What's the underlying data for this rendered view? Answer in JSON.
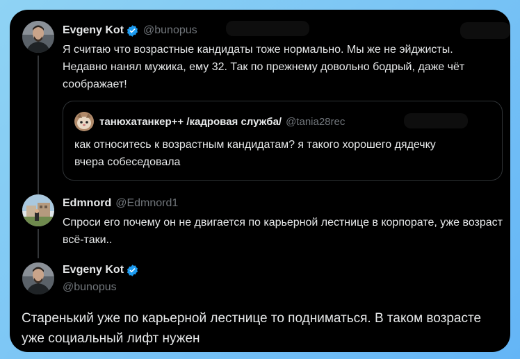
{
  "tweet1": {
    "name": "Evgeny Kot",
    "handle": "@bunopus",
    "text": "Я считаю что возрастные кандидаты тоже нормально. Мы же не эйджисты. Недавно нанял мужика, ему 32. Так по прежнему довольно бодрый, даже чёт соображает!"
  },
  "quote": {
    "name": "танюхатанкер++ /кадровая служба/",
    "handle": "@tania28rec",
    "text": "как относитесь к возрастным кандидатам? я такого хорошего дядечку вчера собеседовала"
  },
  "tweet2": {
    "name": "Edmnord",
    "handle": "@Edmnord1",
    "text": "Спроси его почему он не двигается по карьерной лестнице в корпорате, уже возраст всё-таки.."
  },
  "tweet3": {
    "name": "Evgeny Kot",
    "handle": "@bunopus",
    "text": "Старенький уже по карьерной лестнице то подниматься. В таком возрасте уже социальный лифт нужен"
  },
  "colors": {
    "background": "#000000",
    "text": "#e7e9ea",
    "muted": "#71767b",
    "verified": "#1d9bf0",
    "border": "#2f3336"
  },
  "icons": {
    "verified": "verified-badge-icon"
  }
}
